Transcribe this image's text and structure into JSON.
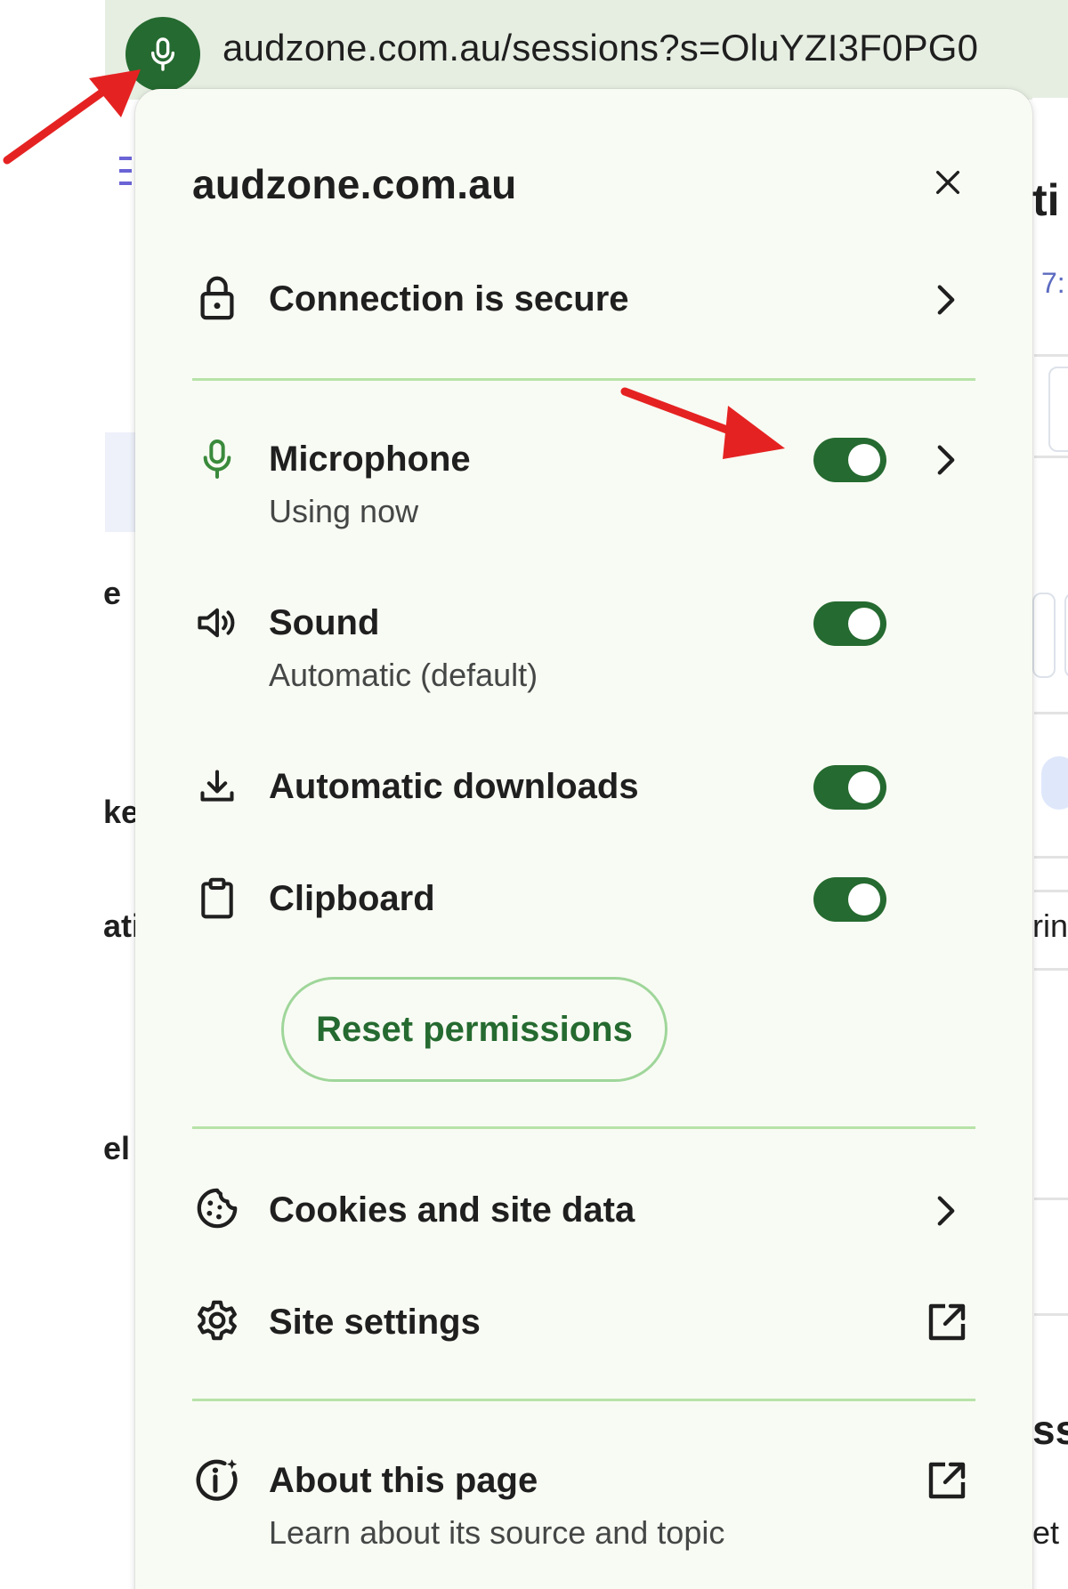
{
  "address_bar": {
    "url": "audzone.com.au/sessions?s=OluYZI3F0PG0",
    "chip_icon": "microphone-icon",
    "chip_color": "#256a30"
  },
  "background_fragments": {
    "left": [
      "e",
      "ke",
      "ati",
      "el"
    ],
    "right": [
      "ti",
      "7:",
      "ss",
      "rin",
      "et"
    ]
  },
  "popup": {
    "title": "audzone.com.au",
    "close_icon": "close-icon",
    "connection": {
      "label": "Connection is secure",
      "icon": "lock-icon"
    },
    "permissions": [
      {
        "label": "Microphone",
        "sublabel": "Using now",
        "icon": "microphone-icon",
        "enabled": true,
        "has_chevron": true
      },
      {
        "label": "Sound",
        "sublabel": "Automatic (default)",
        "icon": "speaker-icon",
        "enabled": true,
        "has_chevron": false
      },
      {
        "label": "Automatic downloads",
        "sublabel": "",
        "icon": "download-icon",
        "enabled": true,
        "has_chevron": false
      },
      {
        "label": "Clipboard",
        "sublabel": "",
        "icon": "clipboard-icon",
        "enabled": true,
        "has_chevron": false
      }
    ],
    "reset_label": "Reset permissions",
    "cookies": {
      "label": "Cookies and site data",
      "icon": "cookie-icon"
    },
    "site_settings": {
      "label": "Site settings",
      "icon": "gear-icon",
      "action_icon": "external-link-icon"
    },
    "about": {
      "label": "About this page",
      "sublabel": "Learn about its source and topic",
      "icon": "info-icon",
      "action_icon": "external-link-icon"
    }
  },
  "colors": {
    "accent": "#256a30",
    "divider": "#b7e3a8",
    "popup_bg": "#f8fbf3",
    "annotation_arrow": "#e52222"
  }
}
